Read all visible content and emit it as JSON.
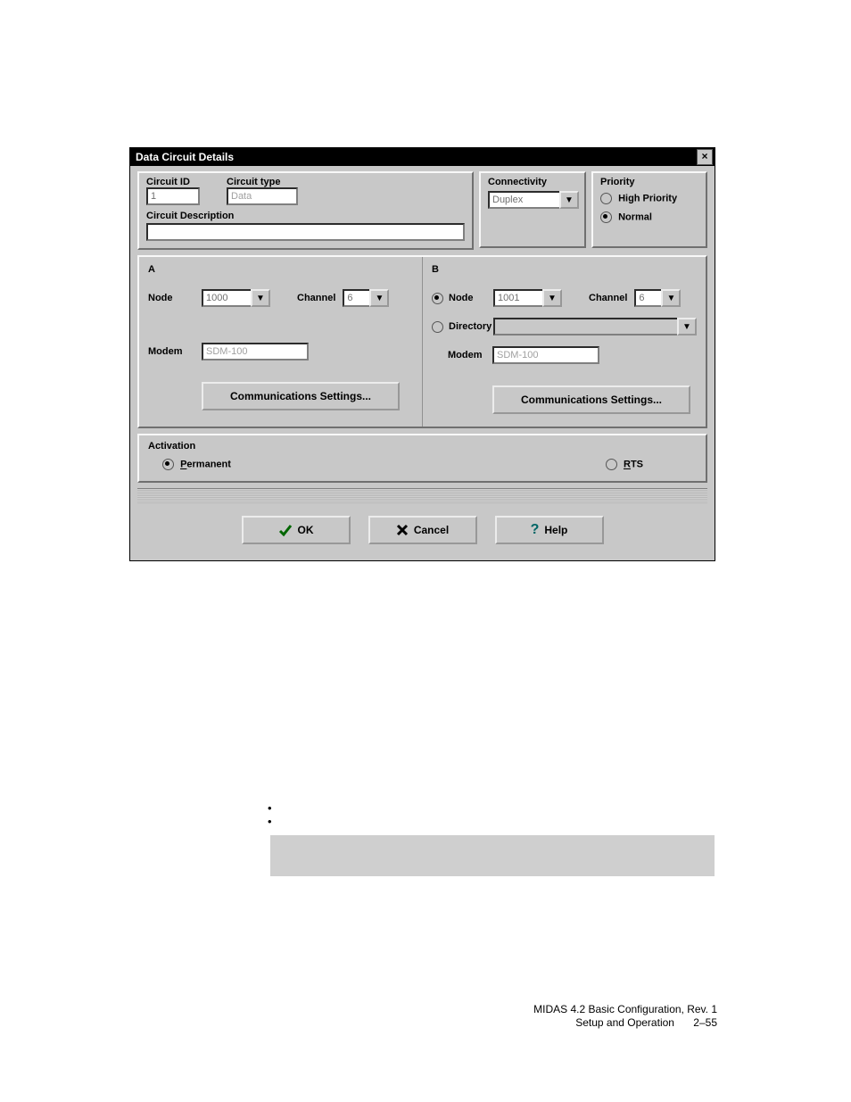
{
  "dialog_title": "Data Circuit Details",
  "header": {
    "circuit_id_label": "Circuit ID",
    "circuit_id_value": "1",
    "circuit_type_label": "Circuit type",
    "circuit_type_value": "Data",
    "circuit_desc_label": "Circuit Description",
    "connectivity_label": "Connectivity",
    "connectivity_value": "Duplex",
    "priority_label": "Priority",
    "priority_high": "High Priority",
    "priority_normal": "Normal"
  },
  "sideA": {
    "title": "A",
    "node_label": "Node",
    "node_value": "1000",
    "channel_label": "Channel",
    "channel_value": "6",
    "modem_label": "Modem",
    "modem_value": "SDM-100",
    "comm_btn": "Communications Settings..."
  },
  "sideB": {
    "title": "B",
    "node_label": "Node",
    "node_value": "1001",
    "channel_label": "Channel",
    "channel_value": "6",
    "directory_label": "Directory",
    "modem_label": "Modem",
    "modem_value": "SDM-100",
    "comm_btn": "Communications Settings..."
  },
  "activation": {
    "title": "Activation",
    "permanent": "Permanent",
    "rts": "RTS"
  },
  "buttons": {
    "ok": "OK",
    "cancel": "Cancel",
    "help": "Help"
  },
  "footer": {
    "line1": "MIDAS 4.2 Basic Configuration, Rev. 1",
    "line2a": "Setup and Operation",
    "line2b": "2–55"
  }
}
